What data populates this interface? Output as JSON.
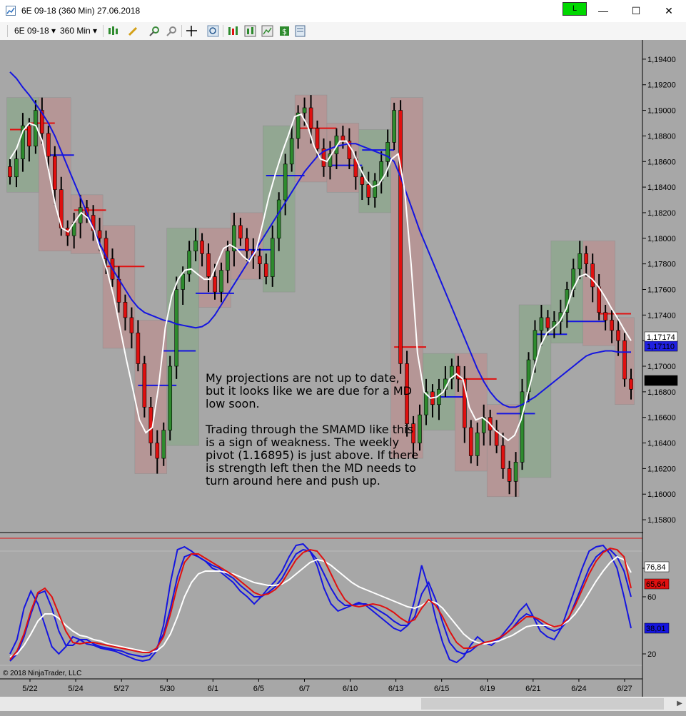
{
  "window": {
    "title": "6E 09-18 (360 Min)  27.06.2018",
    "connection_badge": "L",
    "minimize_glyph": "—",
    "maximize_glyph": "☐",
    "close_glyph": "✕"
  },
  "toolbar": {
    "instrument": "6E 09-18",
    "interval": "360 Min",
    "dropdown_glyph": "▾",
    "icons": [
      "chart-style-icon",
      "drawing-tool-icon",
      "zoom-in-icon",
      "zoom-out-icon",
      "crosshair-icon",
      "search-icon",
      "data-series-icon",
      "indicators-icon",
      "strategies-icon",
      "money-icon",
      "properties-icon"
    ]
  },
  "annotation": {
    "paragraph1": "My projections are not up to date, but it looks like we are due for a MD low soon.",
    "paragraph2": "Trading through the SMAMD like this is a sign of weakness. The weekly pivot (1.16895) is just above. If there is strength left then the MD needs to turn around here and push up."
  },
  "copyright": "© 2018 NinjaTrader, LLC",
  "chart_data": [
    {
      "type": "candlestick",
      "title": "",
      "ylim": [
        1.157,
        1.1955
      ],
      "y_ticks": [
        "1,19400",
        "1,19200",
        "1,19000",
        "1,18800",
        "1,18600",
        "1,18400",
        "1,18200",
        "1,18000",
        "1,17800",
        "1,17600",
        "1,17400",
        "1,17200",
        "1,17000",
        "1,16800",
        "1,16600",
        "1,16400",
        "1,16200",
        "1,16000",
        "1,15800"
      ],
      "y_tick_values": [
        1.194,
        1.192,
        1.19,
        1.188,
        1.186,
        1.184,
        1.182,
        1.18,
        1.178,
        1.176,
        1.174,
        1.172,
        1.17,
        1.168,
        1.166,
        1.164,
        1.162,
        1.16,
        1.158
      ],
      "x_ticks": [
        "5/22",
        "5/24",
        "5/27",
        "5/30",
        "6/1",
        "6/5",
        "6/7",
        "6/10",
        "6/13",
        "6/15",
        "6/19",
        "6/21",
        "6/24",
        "6/27"
      ],
      "price_labels": [
        {
          "text": "1,17174",
          "color": "#ffffff"
        },
        {
          "text": "1,17110",
          "color": "#2020e0"
        },
        {
          "text": "1,16825",
          "color": "#000000"
        }
      ],
      "colors": {
        "up": "#2e8b2e",
        "down": "#e01010",
        "fast_line": "#ffffff",
        "slow_line": "#1515e0",
        "up_box": "#8fa88f",
        "down_box": "#b89494"
      },
      "closes": [
        1.1848,
        1.1862,
        1.1888,
        1.1872,
        1.19,
        1.1882,
        1.1864,
        1.1838,
        1.1808,
        1.1802,
        1.1812,
        1.1824,
        1.1818,
        1.1806,
        1.18,
        1.1784,
        1.1768,
        1.175,
        1.1738,
        1.1726,
        1.1702,
        1.1668,
        1.164,
        1.1628,
        1.165,
        1.17,
        1.176,
        1.1772,
        1.179,
        1.1798,
        1.1788,
        1.177,
        1.1758,
        1.1775,
        1.179,
        1.181,
        1.18,
        1.179,
        1.1786,
        1.178,
        1.177,
        1.18,
        1.183,
        1.1858,
        1.1878,
        1.1898,
        1.1902,
        1.1886,
        1.187,
        1.1856,
        1.1866,
        1.188,
        1.1876,
        1.1862,
        1.1848,
        1.1842,
        1.1832,
        1.1845,
        1.186,
        1.1875,
        1.19,
        1.1702,
        1.1655,
        1.164,
        1.1662,
        1.168,
        1.167,
        1.1682,
        1.169,
        1.17,
        1.169,
        1.1652,
        1.163,
        1.1648,
        1.166,
        1.165,
        1.1638,
        1.162,
        1.161,
        1.1625,
        1.168,
        1.1705,
        1.1728,
        1.1738,
        1.173,
        1.1735,
        1.1742,
        1.176,
        1.1776,
        1.1788,
        1.178,
        1.1762,
        1.1742,
        1.1736,
        1.1728,
        1.172,
        1.169,
        1.1682
      ],
      "fast_ma": [
        1.1862,
        1.187,
        1.1884,
        1.189,
        1.1888,
        1.1876,
        1.1852,
        1.1826,
        1.1808,
        1.1805,
        1.1813,
        1.182,
        1.1816,
        1.1806,
        1.179,
        1.1775,
        1.1755,
        1.173,
        1.1705,
        1.1682,
        1.1658,
        1.1648,
        1.1652,
        1.1685,
        1.173,
        1.1755,
        1.1768,
        1.1775,
        1.1776,
        1.1772,
        1.1768,
        1.1768,
        1.178,
        1.1792,
        1.1795,
        1.1792,
        1.1786,
        1.1782,
        1.179,
        1.181,
        1.1832,
        1.185,
        1.1866,
        1.188,
        1.1895,
        1.1897,
        1.1888,
        1.1872,
        1.1862,
        1.186,
        1.1868,
        1.1876,
        1.1876,
        1.1868,
        1.1856,
        1.1846,
        1.184,
        1.1842,
        1.185,
        1.1862,
        1.1866,
        1.1838,
        1.178,
        1.171,
        1.168,
        1.1675,
        1.1676,
        1.168,
        1.169,
        1.1694,
        1.169,
        1.1668,
        1.1658,
        1.166,
        1.1656,
        1.165,
        1.1646,
        1.1642,
        1.1646,
        1.1658,
        1.1678,
        1.1698,
        1.1716,
        1.1726,
        1.173,
        1.1735,
        1.1745,
        1.176,
        1.177,
        1.1772,
        1.1768,
        1.1762,
        1.1754,
        1.1745,
        1.1737,
        1.1728,
        1.172
      ],
      "slow_ma": [
        1.193,
        1.1925,
        1.1918,
        1.1912,
        1.1905,
        1.1898,
        1.189,
        1.188,
        1.1868,
        1.1856,
        1.1844,
        1.1832,
        1.182,
        1.1808,
        1.1796,
        1.1786,
        1.1776,
        1.1768,
        1.176,
        1.1752,
        1.1746,
        1.1742,
        1.174,
        1.1738,
        1.1736,
        1.1735,
        1.1733,
        1.1732,
        1.1731,
        1.173,
        1.1731,
        1.1734,
        1.174,
        1.1748,
        1.1756,
        1.1764,
        1.1772,
        1.178,
        1.1788,
        1.1796,
        1.1804,
        1.1812,
        1.182,
        1.1828,
        1.1836,
        1.1844,
        1.1852,
        1.1858,
        1.1864,
        1.1868,
        1.187,
        1.1872,
        1.1873,
        1.1874,
        1.1874,
        1.1872,
        1.187,
        1.1868,
        1.1866,
        1.1864,
        1.186,
        1.1848,
        1.1834,
        1.182,
        1.1806,
        1.1794,
        1.1782,
        1.177,
        1.1758,
        1.1746,
        1.1734,
        1.1722,
        1.171,
        1.1698,
        1.1688,
        1.168,
        1.1674,
        1.167,
        1.1668,
        1.1668,
        1.167,
        1.1673,
        1.1676,
        1.168,
        1.1684,
        1.1688,
        1.1692,
        1.1696,
        1.17,
        1.1704,
        1.1708,
        1.171,
        1.1711,
        1.1712,
        1.1712,
        1.1711,
        1.1711,
        1.1711
      ],
      "pivots": [
        {
          "from": 0,
          "to": 3,
          "value": 1.1885,
          "color": "#e01010"
        },
        {
          "from": 3,
          "to": 7,
          "value": 1.189,
          "color": "#e01010"
        },
        {
          "from": 6,
          "to": 10,
          "value": 1.1865,
          "color": "#1515e0"
        },
        {
          "from": 10,
          "to": 15,
          "value": 1.1822,
          "color": "#e01010"
        },
        {
          "from": 15,
          "to": 21,
          "value": 1.1778,
          "color": "#e01010"
        },
        {
          "from": 20,
          "to": 26,
          "value": 1.1685,
          "color": "#1515e0"
        },
        {
          "from": 24,
          "to": 29,
          "value": 1.1712,
          "color": "#1515e0"
        },
        {
          "from": 29,
          "to": 35,
          "value": 1.1757,
          "color": "#1515e0"
        },
        {
          "from": 35,
          "to": 41,
          "value": 1.1791,
          "color": "#1515e0"
        },
        {
          "from": 40,
          "to": 46,
          "value": 1.1849,
          "color": "#1515e0"
        },
        {
          "from": 45,
          "to": 51,
          "value": 1.1886,
          "color": "#e01010"
        },
        {
          "from": 50,
          "to": 55,
          "value": 1.1857,
          "color": "#1515e0"
        },
        {
          "from": 55,
          "to": 60,
          "value": 1.1869,
          "color": "#1515e0"
        },
        {
          "from": 60,
          "to": 65,
          "value": 1.1715,
          "color": "#e01010"
        },
        {
          "from": 65,
          "to": 71,
          "value": 1.1676,
          "color": "#1515e0"
        },
        {
          "from": 70,
          "to": 76,
          "value": 1.169,
          "color": "#e01010"
        },
        {
          "from": 76,
          "to": 82,
          "value": 1.1663,
          "color": "#1515e0"
        },
        {
          "from": 82,
          "to": 87,
          "value": 1.1725,
          "color": "#1515e0"
        },
        {
          "from": 87,
          "to": 93,
          "value": 1.1735,
          "color": "#1515e0"
        },
        {
          "from": 92,
          "to": 97,
          "value": 1.1741,
          "color": "#e01010"
        }
      ]
    },
    {
      "type": "line",
      "title": "",
      "ylim": [
        5,
        105
      ],
      "y_ticks": [
        "80",
        "60",
        "20"
      ],
      "y_tick_values": [
        80,
        60,
        20
      ],
      "value_labels": [
        {
          "text": "76,84",
          "color": "#ffffff"
        },
        {
          "text": "65,64",
          "color": "#e01010"
        },
        {
          "text": "38,01",
          "color": "#1515e0"
        }
      ],
      "series": [
        {
          "color": "#1515e0",
          "values": [
            20,
            30,
            52,
            64,
            55,
            40,
            25,
            20,
            25,
            32,
            30,
            27,
            26,
            24,
            23,
            22,
            20,
            18,
            16,
            15,
            16,
            22,
            40,
            70,
            93,
            95,
            92,
            88,
            85,
            80,
            78,
            74,
            70,
            64,
            60,
            55,
            60,
            66,
            71,
            78,
            88,
            96,
            97,
            92,
            82,
            66,
            55,
            50,
            52,
            54,
            56,
            54,
            50,
            46,
            42,
            38,
            36,
            40,
            58,
            82,
            66,
            45,
            28,
            16,
            14,
            18,
            26,
            32,
            28,
            26,
            30,
            36,
            42,
            50,
            55,
            46,
            36,
            32,
            30,
            38,
            52,
            66,
            80,
            92,
            95,
            96,
            90,
            80,
            60,
            38
          ]
        },
        {
          "color": "#1515e0",
          "values": [
            15,
            20,
            32,
            48,
            62,
            64,
            52,
            36,
            26,
            26,
            30,
            30,
            27,
            25,
            24,
            23,
            22,
            20,
            19,
            18,
            19,
            24,
            34,
            52,
            74,
            88,
            90,
            88,
            85,
            82,
            80,
            76,
            73,
            68,
            64,
            60,
            60,
            63,
            67,
            73,
            82,
            90,
            93,
            92,
            86,
            76,
            66,
            58,
            54,
            54,
            55,
            55,
            53,
            50,
            47,
            43,
            40,
            40,
            46,
            62,
            70,
            58,
            42,
            28,
            22,
            20,
            22,
            26,
            28,
            28,
            30,
            34,
            38,
            44,
            48,
            46,
            42,
            38,
            36,
            38,
            44,
            56,
            68,
            80,
            88,
            92,
            93,
            88,
            78,
            60
          ]
        },
        {
          "color": "#ffffff",
          "values": [
            18,
            20,
            26,
            34,
            43,
            48,
            48,
            45,
            40,
            36,
            33,
            32,
            30,
            29,
            27,
            26,
            25,
            24,
            23,
            22,
            21,
            22,
            26,
            34,
            46,
            60,
            70,
            76,
            78,
            78,
            78,
            77,
            76,
            74,
            72,
            70,
            69,
            68,
            68,
            69,
            72,
            76,
            80,
            84,
            86,
            85,
            82,
            78,
            74,
            70,
            67,
            65,
            63,
            61,
            59,
            57,
            55,
            53,
            52,
            54,
            57,
            56,
            52,
            46,
            40,
            34,
            30,
            28,
            27,
            28,
            29,
            31,
            33,
            36,
            39,
            40,
            40,
            40,
            39,
            40,
            43,
            48,
            55,
            63,
            71,
            78,
            84,
            88,
            86,
            77
          ]
        },
        {
          "color": "#e01010",
          "values": [
            16,
            22,
            34,
            50,
            63,
            66,
            60,
            48,
            36,
            28,
            27,
            28,
            28,
            27,
            26,
            25,
            24,
            23,
            22,
            21,
            21,
            24,
            32,
            48,
            68,
            84,
            90,
            90,
            87,
            84,
            81,
            78,
            75,
            71,
            67,
            63,
            61,
            62,
            65,
            70,
            78,
            86,
            91,
            93,
            92,
            86,
            76,
            66,
            58,
            54,
            53,
            54,
            55,
            54,
            52,
            49,
            45,
            42,
            44,
            52,
            58,
            54,
            46,
            36,
            28,
            24,
            24,
            26,
            28,
            29,
            31,
            34,
            38,
            42,
            46,
            46,
            44,
            41,
            39,
            40,
            45,
            54,
            65,
            76,
            85,
            91,
            94,
            93,
            88,
            66
          ]
        }
      ]
    }
  ]
}
